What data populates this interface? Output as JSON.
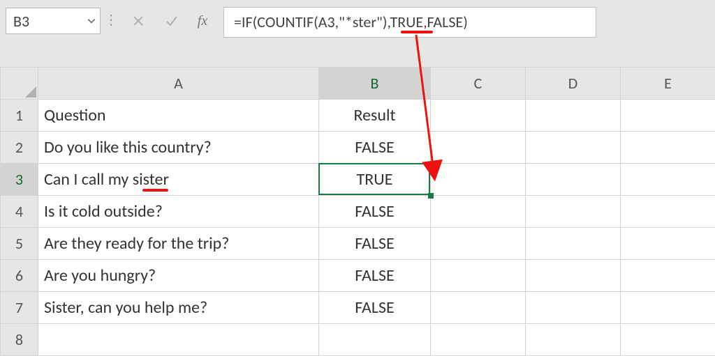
{
  "nameBox": {
    "value": "B3"
  },
  "formulaBar": {
    "cancel_title": "Cancel",
    "enter_title": "Enter",
    "fx_label": "fx",
    "formula": "=IF(COUNTIF(A3,\"*ster\"),TRUE,FALSE)"
  },
  "columns": [
    "A",
    "B",
    "C",
    "D",
    "E"
  ],
  "headers": {
    "colA": "Question",
    "colB": "Result"
  },
  "rows": [
    {
      "n": "1",
      "a": "Question",
      "b": "Result",
      "isHeader": true
    },
    {
      "n": "2",
      "a": "Do you like this country?",
      "b": "FALSE"
    },
    {
      "n": "3",
      "a": "Can I call my sister",
      "b": "TRUE"
    },
    {
      "n": "4",
      "a": "Is it cold outside?",
      "b": "FALSE"
    },
    {
      "n": "5",
      "a": "Are they ready for the trip?",
      "b": "FALSE"
    },
    {
      "n": "6",
      "a": "Are you hungry?",
      "b": "FALSE"
    },
    {
      "n": "7",
      "a": "Sister, can you help me?",
      "b": "FALSE"
    },
    {
      "n": "8",
      "a": "",
      "b": ""
    }
  ],
  "activeCell": "B3",
  "annotations": {
    "underline_formula_fragment": "ster",
    "underline_cell_fragment": "ster",
    "arrow_from": "formula-ster",
    "arrow_to": "B3"
  },
  "chart_data": {
    "type": "table",
    "columns": [
      "Question",
      "Result"
    ],
    "rows": [
      [
        "Do you like this country?",
        "FALSE"
      ],
      [
        "Can I call my sister",
        "TRUE"
      ],
      [
        "Is it cold outside?",
        "FALSE"
      ],
      [
        "Are they ready for the trip?",
        "FALSE"
      ],
      [
        "Are you hungry?",
        "FALSE"
      ],
      [
        "Sister, can you help me?",
        "FALSE"
      ]
    ]
  }
}
